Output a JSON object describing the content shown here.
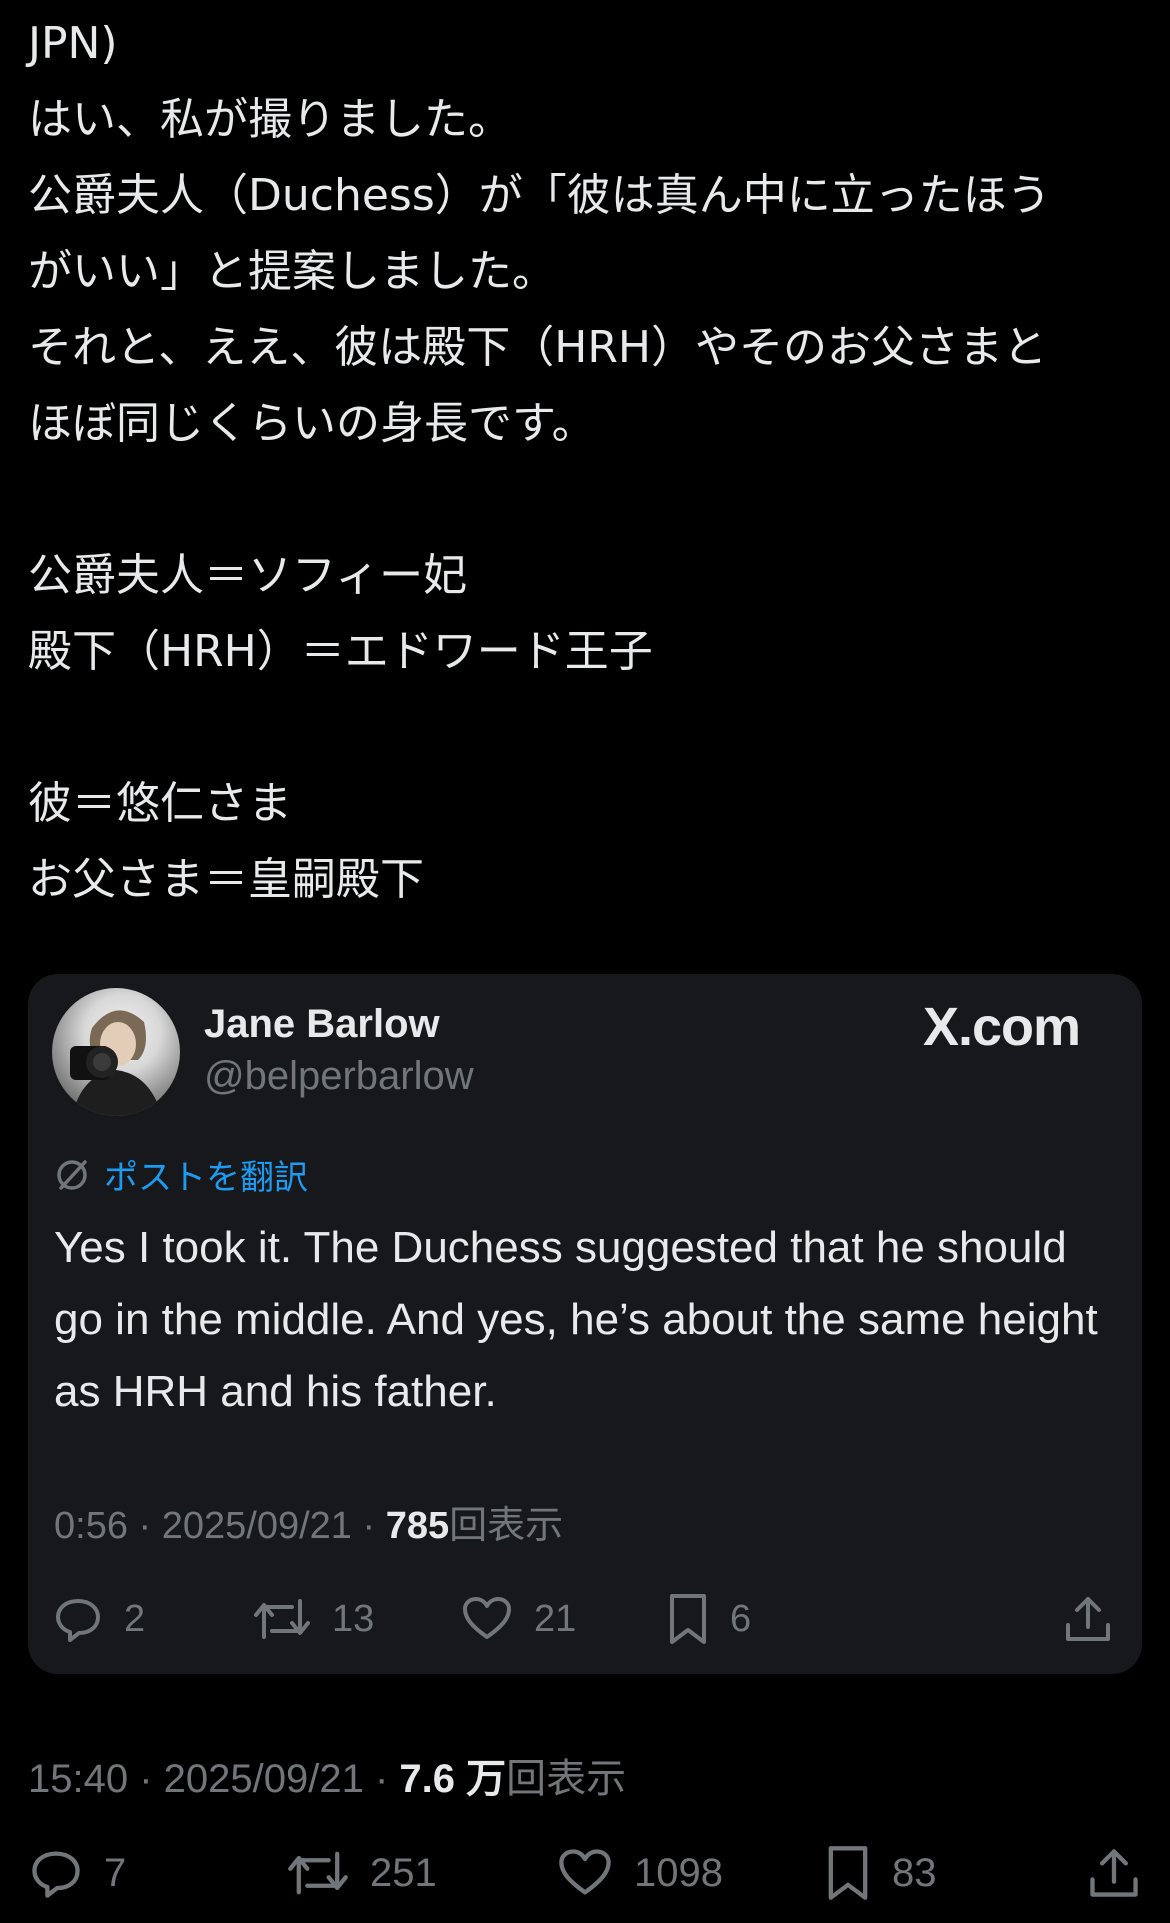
{
  "post": {
    "lines": [
      "JPN)",
      "はい、私が撮りました。",
      "公爵夫人（Duchess）が「彼は真ん中に立ったほう",
      "がいい」と提案しました。",
      "それと、ええ、彼は殿下（HRH）やそのお父さまと",
      "ほぼ同じくらいの身長です。",
      "",
      "公爵夫人＝ソフィー妃",
      "殿下（HRH）＝エドワード王子",
      "",
      "彼＝悠仁さま",
      "お父さま＝皇嗣殿下"
    ]
  },
  "quote": {
    "name": "Jane Barlow",
    "handle": "@belperbarlow",
    "brand": "X.com",
    "translate_label": "ポストを翻訳",
    "text": "Yes I took it. The Duchess suggested that he should go in the middle. And yes, he’s about the same height as HRH and his father.",
    "meta": {
      "time": "0:56",
      "date": "2025/09/21",
      "views": "785",
      "views_label": "回表示",
      "sep": " · "
    },
    "actions": {
      "replies": "2",
      "reposts": "13",
      "likes": "21",
      "bookmarks": "6"
    }
  },
  "main": {
    "meta": {
      "time": "15:40",
      "date": "2025/09/21",
      "views": "7.6 万",
      "views_label": "回表示",
      "sep": " · "
    },
    "actions": {
      "replies": "7",
      "reposts": "251",
      "likes": "1098",
      "bookmarks": "83"
    }
  },
  "icons": {
    "reply": "reply-icon",
    "repost": "repost-icon",
    "like": "heart-icon",
    "bookmark": "bookmark-icon",
    "share": "share-icon",
    "translate": "translate-icon"
  },
  "colors": {
    "background": "#000000",
    "card": "#16181c",
    "text": "#e7e9ea",
    "muted": "#71767b",
    "accent": "#1d9bf0"
  }
}
